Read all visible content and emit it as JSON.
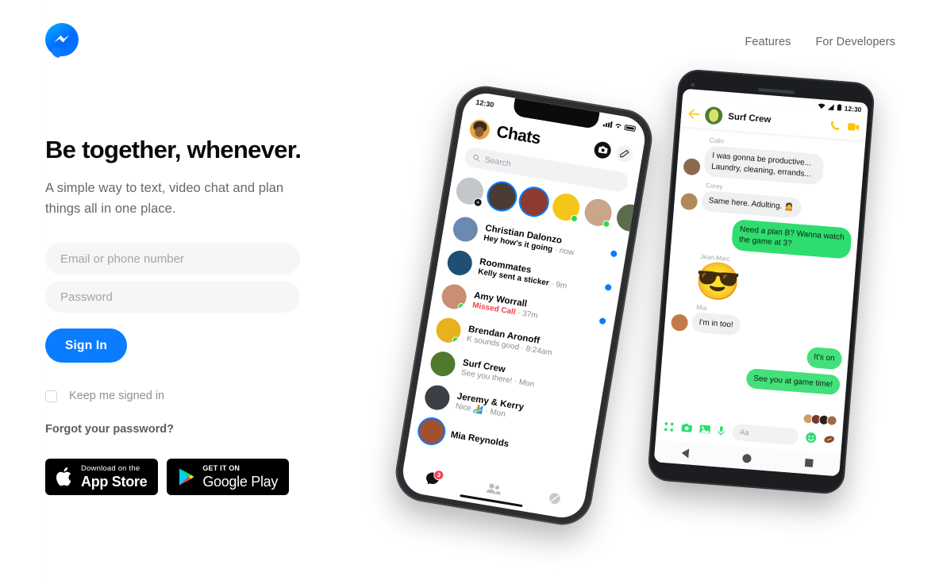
{
  "header": {
    "logo_name": "messenger-logo",
    "nav": [
      {
        "label": "Features"
      },
      {
        "label": "For Developers"
      }
    ]
  },
  "hero": {
    "headline": "Be together, whenever.",
    "subhead": "A simple way to text, video chat and plan things all in one place."
  },
  "login": {
    "email_placeholder": "Email or phone number",
    "email_value": "",
    "password_placeholder": "Password",
    "password_value": "",
    "signin_label": "Sign In",
    "keep_signed_in_label": "Keep me signed in",
    "keep_signed_in_checked": false,
    "forgot_label": "Forgot your password?"
  },
  "store_badges": [
    {
      "name": "app-store",
      "small": "Download on the",
      "large": "App Store"
    },
    {
      "name": "google-play",
      "small": "GET IT ON",
      "large": "Google Play"
    }
  ],
  "colors": {
    "brand_blue": "#0A7CFF",
    "logo_gradient_start": "#00B2FF",
    "logo_gradient_end": "#006AFF",
    "missed_call_red": "#FA3C4C",
    "online_green": "#31D84A",
    "android_accent_green": "#2FDD6F",
    "android_accent_yellow": "#FFC400",
    "text_dark": "#050505",
    "text_gray": "#65686C",
    "field_bg": "#F6F6F7"
  },
  "iphone": {
    "status_time": "12:30",
    "title": "Chats",
    "search_placeholder": "Search",
    "camera_icon": "camera-icon",
    "compose_icon": "compose-icon",
    "stories": [
      {
        "name": "your-story",
        "ring": false,
        "badge": "plus",
        "color": "#c2c7cc"
      },
      {
        "name": "story-1",
        "ring": true,
        "badge": "none",
        "color": "#4a3b33"
      },
      {
        "name": "story-2",
        "ring": true,
        "badge": "none",
        "color": "#8c3b2e"
      },
      {
        "name": "story-3",
        "ring": false,
        "badge": "online",
        "color": "#f5c518"
      },
      {
        "name": "story-4",
        "ring": false,
        "badge": "online",
        "color": "#c9a58a"
      },
      {
        "name": "story-5",
        "ring": false,
        "badge": "none",
        "color": "#5c6b4a"
      }
    ],
    "chats": [
      {
        "name": "Christian Dalonzo",
        "preview": "Hey how's it going",
        "time": "now",
        "unread": true,
        "online": false,
        "missed": false,
        "color": "#6b8ab0"
      },
      {
        "name": "Roommates",
        "preview": "Kelly sent a sticker",
        "time": "9m",
        "unread": true,
        "online": false,
        "missed": false,
        "color": "#1f4f73"
      },
      {
        "name": "Amy Worrall",
        "preview": "Missed Call",
        "time": "37m",
        "unread": true,
        "online": true,
        "missed": true,
        "color": "#c98e73"
      },
      {
        "name": "Brendan Aronoff",
        "preview": "K sounds good",
        "time": "8:24am",
        "unread": false,
        "online": true,
        "missed": false,
        "color": "#e8b21f"
      },
      {
        "name": "Surf Crew",
        "preview": "See you there!",
        "time": "Mon",
        "unread": false,
        "online": false,
        "missed": false,
        "color": "#4f7a2e"
      },
      {
        "name": "Jeremy & Kerry",
        "preview": "Nice 🏄",
        "time": "Mon",
        "unread": false,
        "online": false,
        "missed": false,
        "color": "#3c3f45"
      },
      {
        "name": "Mia Reynolds",
        "preview": "",
        "time": "",
        "unread": false,
        "online": false,
        "missed": false,
        "color": "#a0512e"
      }
    ],
    "tabs": [
      {
        "name": "tab-chats",
        "icon": "chat-bubble-icon",
        "badge": "3"
      },
      {
        "name": "tab-people",
        "icon": "people-icon",
        "badge": ""
      },
      {
        "name": "tab-profile",
        "icon": "avatar-icon",
        "badge": ""
      }
    ]
  },
  "android": {
    "status_time": "12:30",
    "title": "Surf Crew",
    "back_icon": "back-arrow-icon",
    "call_icon": "phone-icon",
    "video_icon": "video-camera-icon",
    "messages": [
      {
        "sender": "Colin",
        "text": "I was gonna be productive... Laundry, cleaning, errands...",
        "out": false,
        "color": "#8a6b4f"
      },
      {
        "sender": "Corey",
        "text": "Same here. Adulting. 🙍",
        "out": false,
        "color": "#b08a5c"
      },
      {
        "sender": "",
        "text": "Need a plan B? Wanna watch the game at 3?",
        "out": true,
        "color": ""
      },
      {
        "sender": "Jean-Marc",
        "text": "😎",
        "out": false,
        "emoji": true,
        "color": "#3a3d41"
      },
      {
        "sender": "Mia",
        "text": "I'm in too!",
        "out": false,
        "color": "#c27a4a"
      },
      {
        "sender": "",
        "text": "It's on",
        "out": true,
        "color": ""
      },
      {
        "sender": "",
        "text": "See you at game time!",
        "out": true,
        "color": ""
      }
    ],
    "input_placeholder": "Aa",
    "toolbar_icons": [
      {
        "name": "apps-grid-icon"
      },
      {
        "name": "camera-icon"
      },
      {
        "name": "photo-icon"
      },
      {
        "name": "microphone-icon"
      }
    ],
    "emoji_icon": "smiley-icon",
    "sticker_icon": "football-sticker-icon",
    "nav_icons": [
      {
        "name": "android-back-icon"
      },
      {
        "name": "android-home-icon"
      },
      {
        "name": "android-recents-icon"
      }
    ]
  }
}
